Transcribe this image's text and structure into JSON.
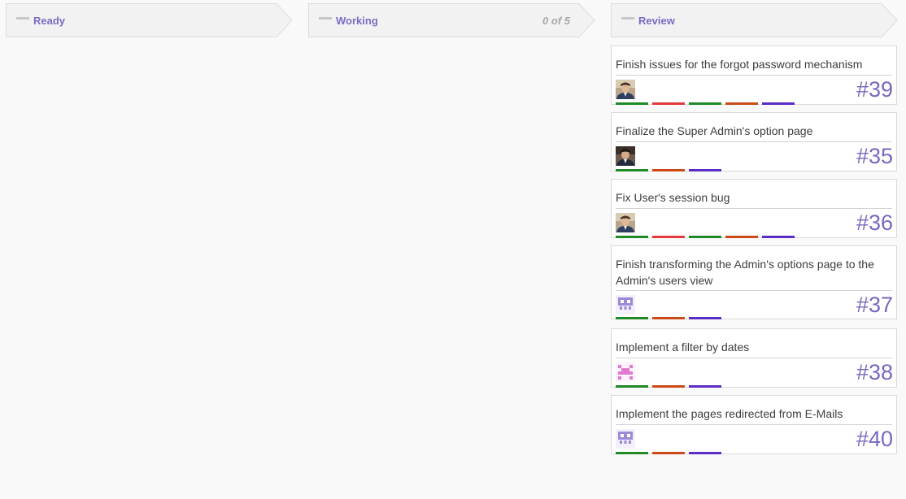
{
  "columns": [
    {
      "title": "Ready",
      "count": "",
      "cards": []
    },
    {
      "title": "Working",
      "count": "0 of 5",
      "cards": []
    },
    {
      "title": "Review",
      "count": "",
      "cards": [
        {
          "title": "Finish issues for the forgot password mechanism",
          "number": "#39",
          "avatar": "user-photo-light",
          "labels": [
            "#1f8a26",
            "#e33b3b",
            "#1f8a26",
            "#cc4a17",
            "#5a2dc6"
          ]
        },
        {
          "title": "Finalize the Super Admin's option page",
          "number": "#35",
          "avatar": "user-photo-dark",
          "labels": [
            "#1f8a26",
            "#cc4a17",
            "#5a2dc6"
          ]
        },
        {
          "title": "Fix User's session bug",
          "number": "#36",
          "avatar": "user-photo-light",
          "labels": [
            "#1f8a26",
            "#e33b3b",
            "#1f8a26",
            "#cc4a17",
            "#5a2dc6"
          ]
        },
        {
          "title": "Finish transforming the Admin's options page to the Admin's users view",
          "number": "#37",
          "avatar": "identicon-purple",
          "labels": [
            "#1f8a26",
            "#cc4a17",
            "#5a2dc6"
          ]
        },
        {
          "title": "Implement a filter by dates",
          "number": "#38",
          "avatar": "identicon-pink",
          "labels": [
            "#1f8a26",
            "#cc4a17",
            "#5a2dc6"
          ]
        },
        {
          "title": "Implement the pages redirected from E-Mails",
          "number": "#40",
          "avatar": "identicon-purple",
          "labels": [
            "#1f8a26",
            "#cc4a17",
            "#5a2dc6"
          ]
        }
      ]
    }
  ],
  "colors": {
    "accent": "#7a6bc4",
    "issue_number": "#7669c0",
    "header_bg": "#f2f2f2",
    "header_border": "#dcdcdc"
  }
}
